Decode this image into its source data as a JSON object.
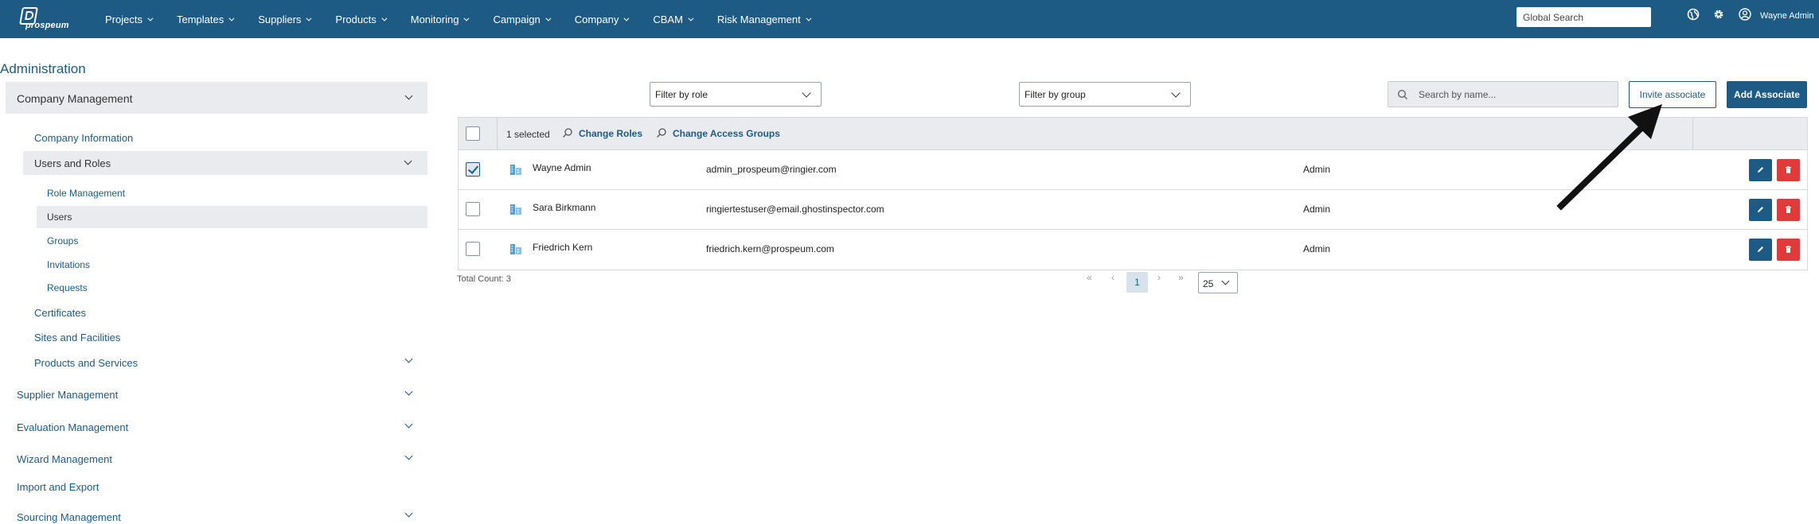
{
  "brand": {
    "logo_text": "prospeum"
  },
  "nav": [
    {
      "label": "Projects"
    },
    {
      "label": "Templates"
    },
    {
      "label": "Suppliers"
    },
    {
      "label": "Products"
    },
    {
      "label": "Monitoring"
    },
    {
      "label": "Campaign"
    },
    {
      "label": "Company"
    },
    {
      "label": "CBAM"
    },
    {
      "label": "Risk Management"
    }
  ],
  "header": {
    "global_search_placeholder": "Global Search",
    "user_name": "Wayne Admin"
  },
  "sidebar": {
    "title": "Administration",
    "company_management": "Company Management",
    "company_information": "Company Information",
    "users_and_roles": "Users and Roles",
    "role_management": "Role Management",
    "users": "Users",
    "groups": "Groups",
    "invitations": "Invitations",
    "requests": "Requests",
    "certificates": "Certificates",
    "sites_and_facilities": "Sites and Facilities",
    "products_and_services": "Products and Services",
    "supplier_management": "Supplier Management",
    "evaluation_management": "Evaluation Management",
    "wizard_management": "Wizard Management",
    "import_and_export": "Import and Export",
    "sourcing_management": "Sourcing Management"
  },
  "toolbar": {
    "filter_role": "Filter by role",
    "filter_group": "Filter by group",
    "search_placeholder": "Search by name...",
    "invite_label": "Invite associate",
    "add_label": "Add Associate"
  },
  "table": {
    "selected_text": "1 selected",
    "change_roles": "Change Roles",
    "change_access_groups": "Change Access Groups",
    "rows": [
      {
        "name": "Wayne Admin",
        "email": "admin_prospeum@ringier.com",
        "role": "Admin",
        "checked": true
      },
      {
        "name": "Sara Birkmann",
        "email": "ringiertestuser@email.ghostinspector.com",
        "role": "Admin",
        "checked": false
      },
      {
        "name": "Friedrich Kern",
        "email": "friedrich.kern@prospeum.com",
        "role": "Admin",
        "checked": false
      }
    ]
  },
  "footer": {
    "total_count": "Total Count: 3",
    "current_page": "1",
    "page_size": "25",
    "first": "«",
    "prev": "‹",
    "next": "›",
    "last": "»"
  },
  "colors": {
    "brand": "#1d5a84",
    "danger": "#e03a3a",
    "panel": "#e9ebee"
  }
}
